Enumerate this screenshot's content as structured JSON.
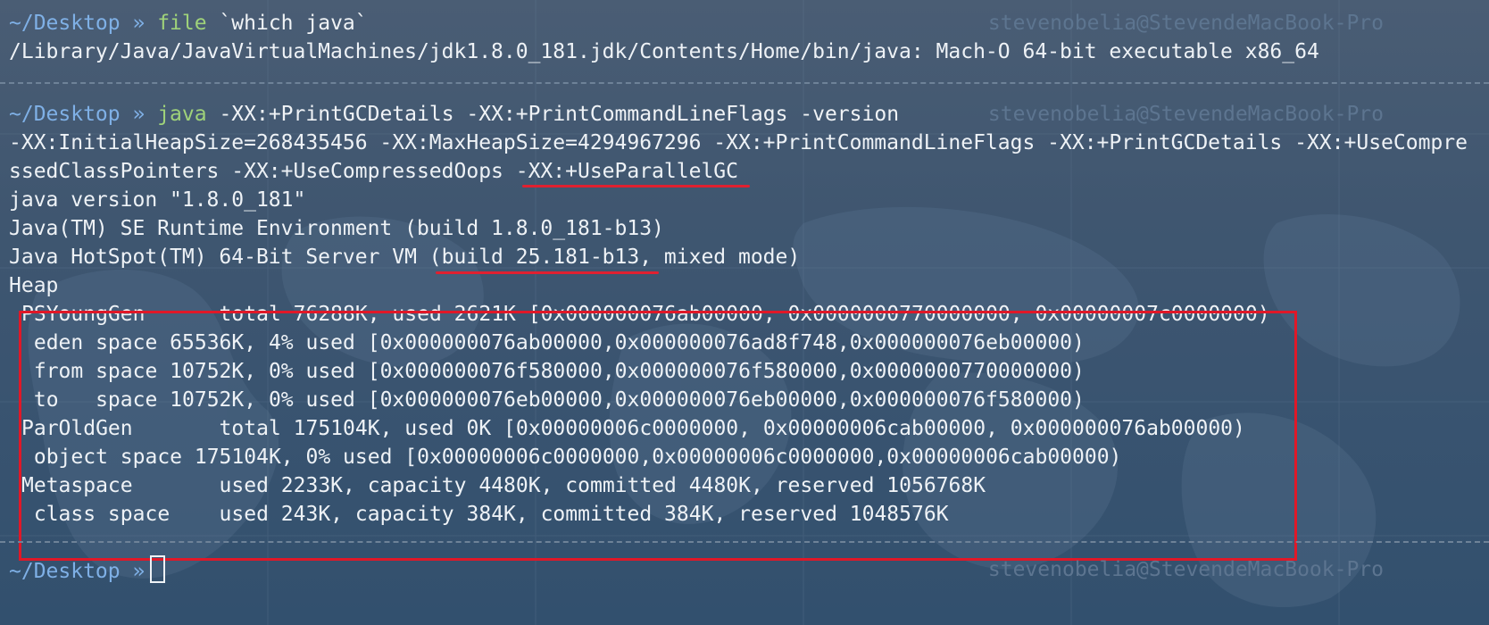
{
  "terminal": {
    "prompts": [
      {
        "cwd": "~/Desktop",
        "arrow": "»",
        "command": "file",
        "args": " `which java`",
        "host": "stevenobelia@StevendeMacBook-Pro"
      },
      {
        "cwd": "~/Desktop",
        "arrow": "»",
        "command": "java",
        "args": " -XX:+PrintGCDetails -XX:+PrintCommandLineFlags -version",
        "host": "stevenobelia@StevendeMacBook-Pro"
      },
      {
        "cwd": "~/Desktop",
        "arrow": "»",
        "host": "stevenobelia@StevendeMacBook-Pro"
      }
    ],
    "output": {
      "file_result": "/Library/Java/JavaVirtualMachines/jdk1.8.0_181.jdk/Contents/Home/bin/java: Mach-O 64-bit executable x86_64",
      "flags_line1": "-XX:InitialHeapSize=268435456 -XX:MaxHeapSize=4294967296 -XX:+PrintCommandLineFlags -XX:+PrintGCDetails -XX:+UseCompre",
      "flags_line2": "ssedClassPointers -XX:+UseCompressedOops -XX:+UseParallelGC",
      "java_version": "java version \"1.8.0_181\"",
      "runtime_env": "Java(TM) SE Runtime Environment (build 1.8.0_181-b13)",
      "hotspot_vm": "Java HotSpot(TM) 64-Bit Server VM (build 25.181-b13, mixed mode)",
      "heap_title": "Heap",
      "heap_lines": [
        "PSYoungGen      total 76288K, used 2621K [0x000000076ab00000, 0x0000000770000000, 0x00000007c0000000)",
        " eden space 65536K, 4% used [0x000000076ab00000,0x000000076ad8f748,0x000000076eb00000)",
        " from space 10752K, 0% used [0x000000076f580000,0x000000076f580000,0x0000000770000000)",
        " to   space 10752K, 0% used [0x000000076eb00000,0x000000076eb00000,0x000000076f580000)",
        "ParOldGen       total 175104K, used 0K [0x00000006c0000000, 0x00000006cab00000, 0x000000076ab00000)",
        " object space 175104K, 0% used [0x00000006c0000000,0x00000006c0000000,0x00000006cab00000)",
        "Metaspace       used 2233K, capacity 4480K, committed 4480K, reserved 1056768K",
        " class space    used 243K, capacity 384K, committed 384K, reserved 1048576K"
      ]
    },
    "colors": {
      "background": "#3f5670",
      "cwd": "#7fb0e6",
      "command": "#9fd27a",
      "annotation_red": "#e01828"
    }
  }
}
